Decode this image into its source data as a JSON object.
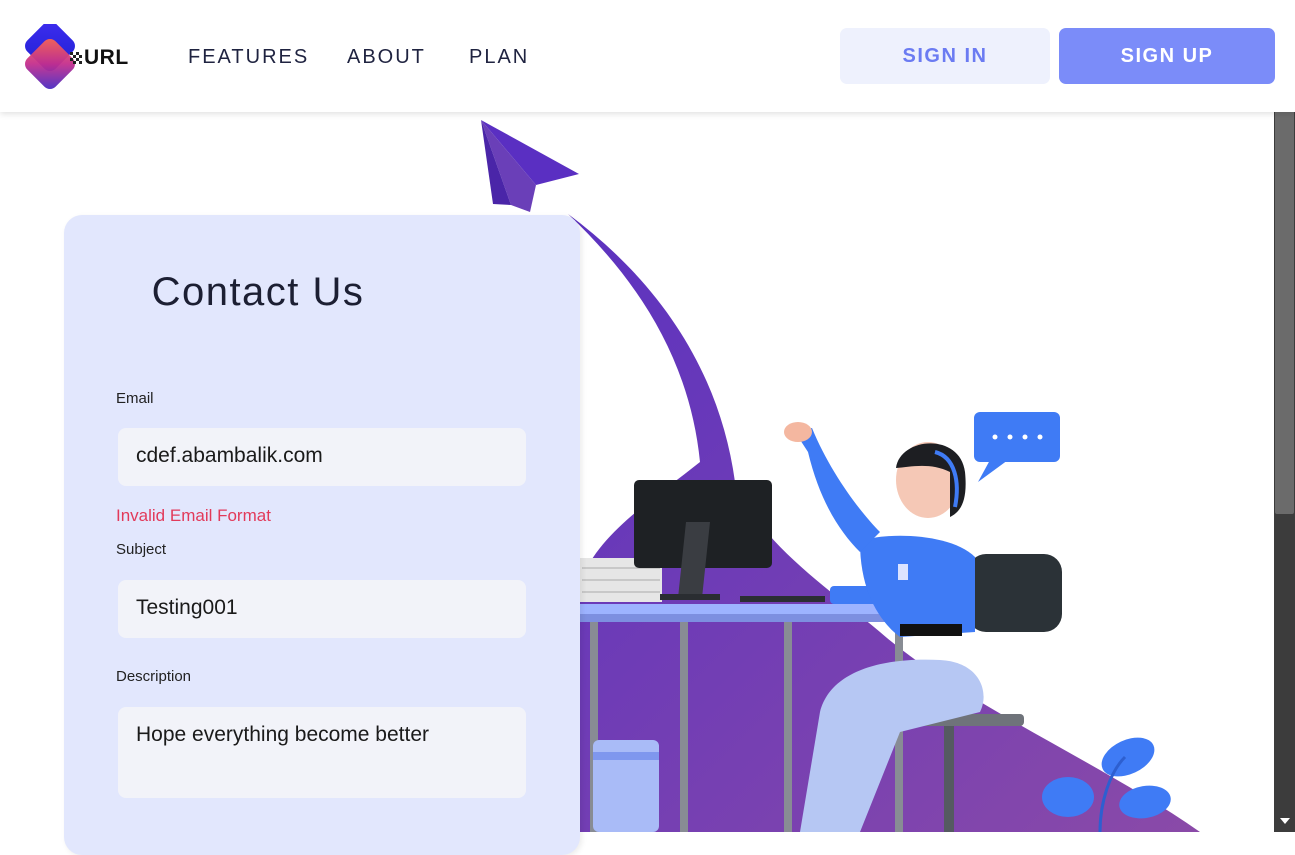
{
  "header": {
    "logo_text": "URL",
    "nav": [
      "FEATURES",
      "ABOUT",
      "PLAN"
    ],
    "sign_in_label": "SIGN IN",
    "sign_up_label": "SIGN UP"
  },
  "contact": {
    "title": "Contact Us",
    "email_label": "Email",
    "email_value": "cdef.abambalik.com",
    "email_error": "Invalid Email Format",
    "subject_label": "Subject",
    "subject_value": "Testing001",
    "description_label": "Description",
    "description_value": "Hope everything become better"
  },
  "colors": {
    "accent": "#7b8cf9",
    "accent_light": "#eef1fd",
    "card_bg": "#e2e7fd",
    "error": "#e23a5a",
    "illustration_purple": "#6a3fb8"
  },
  "icons": [
    "logo-icon",
    "paper-plane-icon",
    "chat-bubble-icon",
    "scroll-down-arrow-icon"
  ]
}
